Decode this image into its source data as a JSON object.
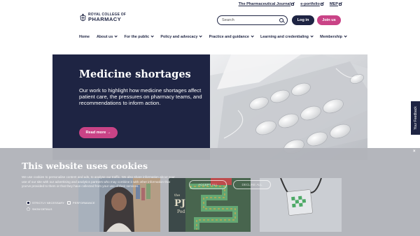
{
  "utility_links": [
    {
      "label": "The Pharmaceutical Journal"
    },
    {
      "label": "e-portfolio"
    },
    {
      "label": "MEP"
    }
  ],
  "logo": {
    "line1": "ROYAL COLLEGE OF",
    "line2": "PHARMACY"
  },
  "search": {
    "placeholder": "Search"
  },
  "header": {
    "login_label": "Log in",
    "join_label": "Join us"
  },
  "nav": [
    {
      "label": "Home",
      "has_dropdown": false
    },
    {
      "label": "About us",
      "has_dropdown": true
    },
    {
      "label": "For the public",
      "has_dropdown": true
    },
    {
      "label": "Policy and advocacy",
      "has_dropdown": true
    },
    {
      "label": "Practice and guidance",
      "has_dropdown": true
    },
    {
      "label": "Learning and credentialing",
      "has_dropdown": true
    },
    {
      "label": "Membership",
      "has_dropdown": true
    }
  ],
  "hero": {
    "title": "Medicine shortages",
    "text": "Our work to highlight how medicine shortages affect patient care, the pressures on pharmacy teams, and recommendations to inform action.",
    "button_label": "Read more →"
  },
  "feedback": {
    "label": "Your Feedback"
  },
  "cookie": {
    "title": "This website uses cookies",
    "text": "We use cookies to personalise content and ads, to analyse our traffic. We also share information about your use of our site with our advertising and analytics partners who may combine it with other information that you've provided to them or that they have collected from your use of their services.",
    "checkbox_necessary": "STRICTLY NECESSARY",
    "checkbox_performance": "PERFORMANCE",
    "show_details": "SHOW DETAILS",
    "accept_label": "ACCEPT ALL",
    "decline_label": "DECLINE ALL",
    "close_label": "×"
  },
  "cards": [
    {
      "image": "woman-portrait"
    },
    {
      "image": "pj-pod-board-game",
      "overlay_text_1": "the",
      "overlay_text_2": "PJ",
      "overlay_text_3": "Pod"
    },
    {
      "image": "lanyard-badge"
    }
  ],
  "colors": {
    "navy": "#1e2443",
    "magenta": "#c94386",
    "overlay": "#b2b4ba"
  }
}
